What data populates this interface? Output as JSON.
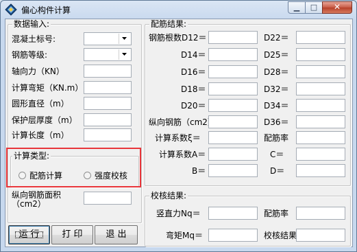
{
  "window": {
    "title": "偏心构件计算"
  },
  "input": {
    "title": "数据输入:",
    "concrete_label": "混凝土标号:",
    "concrete_value": "",
    "steel_label": "钢筋等级:",
    "steel_value": "",
    "axial_label": "轴向力（KN）",
    "axial_value": "",
    "moment_label": "计算弯矩（KN.m）",
    "moment_value": "",
    "diameter_label": "圆形直径（m）",
    "diameter_value": "",
    "cover_label": "保护层厚度（m）",
    "cover_value": "",
    "length_label": "计算长度（m）",
    "length_value": ""
  },
  "calc_type": {
    "title": "计算类型:",
    "option_reinforce": "配筋计算",
    "option_check": "强度校核"
  },
  "area": {
    "label": "纵向钢筋面积（cm2）",
    "value": ""
  },
  "buttons": {
    "run": "运 行",
    "print": "打 印",
    "exit": "退 出"
  },
  "results": {
    "title": "配筋结果:",
    "d12": "钢筋根数D12＝",
    "d14": "D14＝",
    "d16": "D16＝",
    "d18": "D18＝",
    "d20": "D20＝",
    "d22": "D22＝",
    "d25": "D25＝",
    "d28": "D28＝",
    "d32": "D32＝",
    "d34": "D34＝",
    "d36": "D36＝",
    "long_steel": "纵向钢筋（cm2）",
    "coef_xi": "计算系数ξ＝",
    "ratio": "配筋率",
    "coef_a": "计算系数A＝",
    "c": "C＝",
    "b": "B＝",
    "d": "D＝"
  },
  "check": {
    "title": "校核结果:",
    "nq": "竖直力Nq＝",
    "ratio": "配筋率",
    "mq": "弯矩Mq＝",
    "result": "校核结果"
  }
}
